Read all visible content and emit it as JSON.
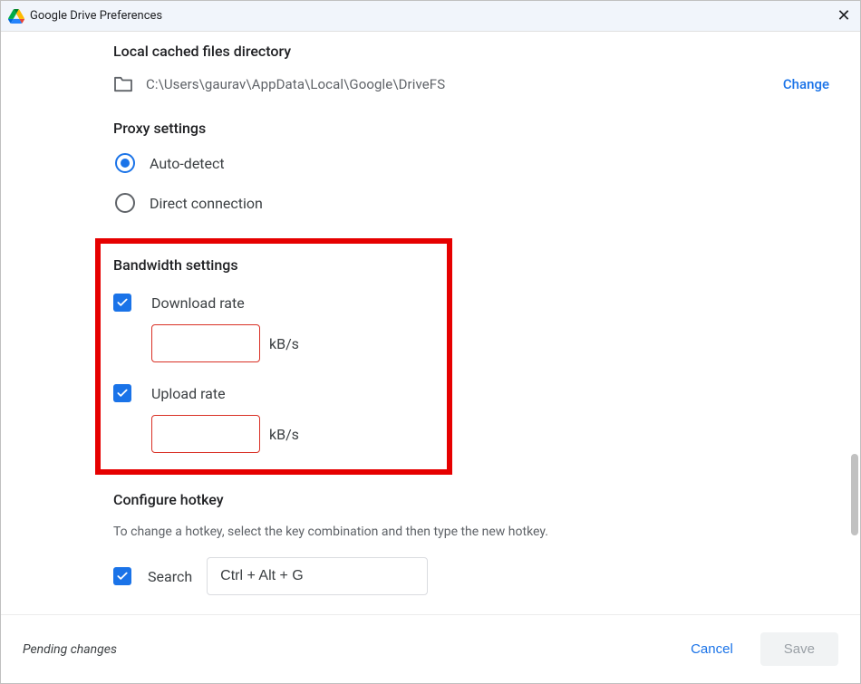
{
  "window": {
    "title": "Google Drive Preferences"
  },
  "cache": {
    "title": "Local cached files directory",
    "path": "C:\\Users\\gaurav\\AppData\\Local\\Google\\DriveFS",
    "change": "Change"
  },
  "proxy": {
    "title": "Proxy settings",
    "auto": "Auto-detect",
    "direct": "Direct connection"
  },
  "bandwidth": {
    "title": "Bandwidth settings",
    "download": "Download rate",
    "download_unit": "kB/s",
    "upload": "Upload rate",
    "upload_unit": "kB/s"
  },
  "hotkey": {
    "title": "Configure hotkey",
    "desc": "To change a hotkey, select the key combination and then type the new hotkey.",
    "search_label": "Search",
    "value": "Ctrl + Alt + G"
  },
  "footer": {
    "pending": "Pending changes",
    "cancel": "Cancel",
    "save": "Save"
  }
}
